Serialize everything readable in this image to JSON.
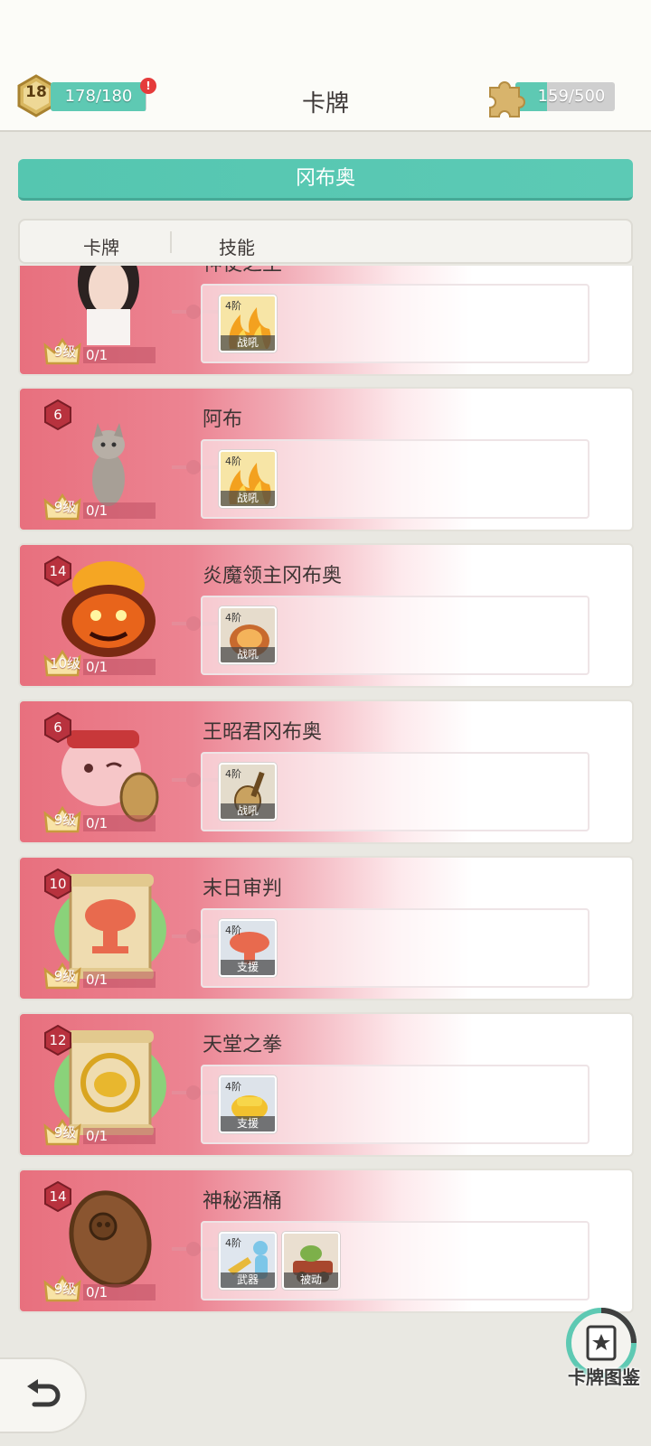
{
  "header": {
    "player_level": "18",
    "energy_text": "178/180",
    "energy_fraction": 0.989,
    "alert_mark": "!",
    "title": "卡牌",
    "puzzle_text": "159/500",
    "puzzle_fraction": 0.318
  },
  "banner": {
    "label": "冈布奥"
  },
  "tabs": [
    {
      "label": "卡牌"
    },
    {
      "label": "技能"
    }
  ],
  "cards": [
    {
      "name": "神使之王",
      "badge": "",
      "art": "girl-portrait",
      "level": "9级",
      "progress": "0/1",
      "skills": [
        {
          "tier": "4阶",
          "type": "战吼",
          "icon": "flame-icon"
        }
      ]
    },
    {
      "name": "阿布",
      "badge": "6",
      "art": "cat-portrait",
      "level": "9级",
      "progress": "0/1",
      "skills": [
        {
          "tier": "4阶",
          "type": "战吼",
          "icon": "flame-icon"
        }
      ]
    },
    {
      "name": "炎魔领主冈布奥",
      "badge": "14",
      "art": "fire-demon-portrait",
      "level": "10级",
      "progress": "0/1",
      "skills": [
        {
          "tier": "4阶",
          "type": "战吼",
          "icon": "fire-demon-skill-icon"
        }
      ]
    },
    {
      "name": "王昭君冈布奥",
      "badge": "6",
      "art": "wang-zhaojun-portrait",
      "level": "9级",
      "progress": "0/1",
      "skills": [
        {
          "tier": "4阶",
          "type": "战吼",
          "icon": "lute-icon"
        }
      ]
    },
    {
      "name": "末日审判",
      "badge": "10",
      "art": "mushroom-cloud-scroll",
      "level": "9级",
      "progress": "0/1",
      "skills": [
        {
          "tier": "4阶",
          "type": "支援",
          "icon": "mushroom-cloud-icon"
        }
      ]
    },
    {
      "name": "天堂之拳",
      "badge": "12",
      "art": "fist-scroll",
      "level": "9级",
      "progress": "0/1",
      "skills": [
        {
          "tier": "4阶",
          "type": "支援",
          "icon": "golden-fist-icon"
        }
      ]
    },
    {
      "name": "神秘酒桶",
      "badge": "14",
      "art": "barrel-portrait",
      "level": "9级",
      "progress": "0/1",
      "skills": [
        {
          "tier": "4阶",
          "type": "武器",
          "icon": "weapon-figure-icon"
        },
        {
          "tier": "",
          "type": "被动",
          "icon": "goblin-cart-icon"
        }
      ]
    }
  ],
  "footer": {
    "back_icon": "back-arrow-icon",
    "codex_label": "卡牌图鉴"
  },
  "colors": {
    "accent_teal": "#5ec9b3",
    "card_pink": "#e8707e",
    "badge_red": "#b8323e"
  }
}
